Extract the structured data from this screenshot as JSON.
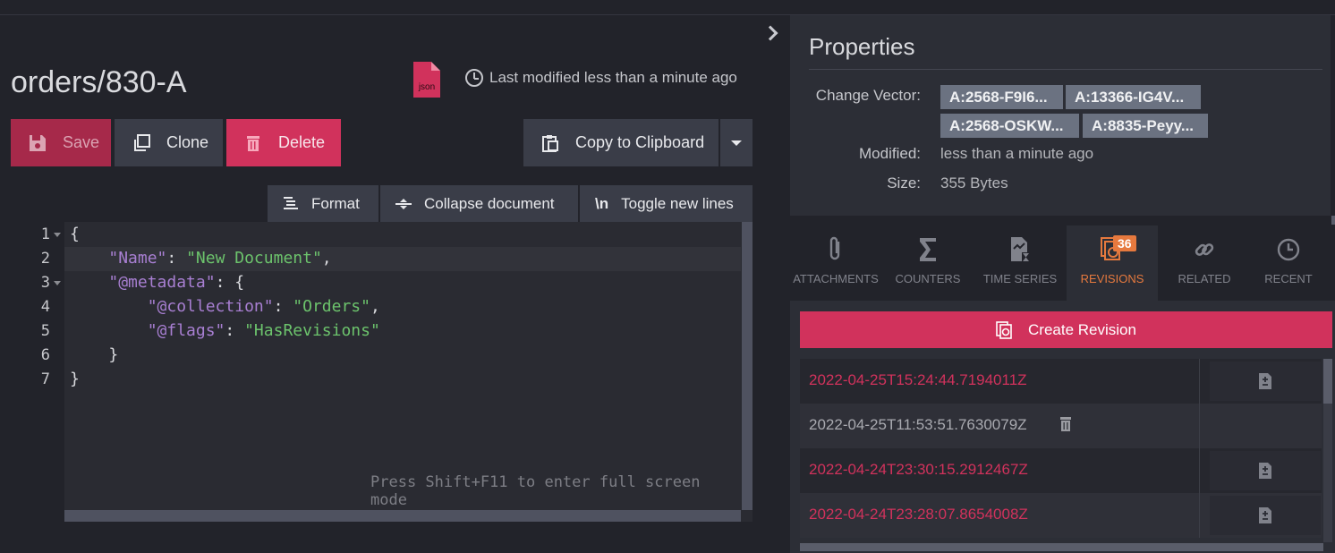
{
  "document": {
    "title": "orders/830-A",
    "json_badge": "json",
    "modified_text": "Last modified less than a minute ago"
  },
  "toolbar": {
    "save_label": "Save",
    "clone_label": "Clone",
    "delete_label": "Delete",
    "copy_label": "Copy to Clipboard"
  },
  "editor_toolbar": {
    "format_label": "Format",
    "collapse_label": "Collapse document",
    "toggle_label": "Toggle new lines",
    "toggle_glyph": "\\n"
  },
  "editor": {
    "line_numbers": [
      "1",
      "2",
      "3",
      "4",
      "5",
      "6",
      "7"
    ],
    "lines": {
      "l1": "{",
      "l2_key": "\"Name\"",
      "l2_sep": ": ",
      "l2_val": "\"New Document\"",
      "l2_end": ",",
      "l3_key": "\"@metadata\"",
      "l3_sep": ": {",
      "l4_key": "\"@collection\"",
      "l4_sep": ": ",
      "l4_val": "\"Orders\"",
      "l4_end": ",",
      "l5_key": "\"@flags\"",
      "l5_sep": ": ",
      "l5_val": "\"HasRevisions\"",
      "l6": "}",
      "l7": "}"
    },
    "hint": "Press Shift+F11 to enter full screen mode"
  },
  "properties": {
    "title": "Properties",
    "change_vector_label": "Change Vector:",
    "change_vectors": [
      "A:2568-F9I6...",
      "A:13366-IG4V...",
      "A:2568-OSKW...",
      "A:8835-Peyy..."
    ],
    "modified_label": "Modified:",
    "modified_value": "less than a minute ago",
    "size_label": "Size:",
    "size_value": "355 Bytes"
  },
  "tabs": [
    {
      "label": "ATTACHMENTS",
      "icon": "paperclip-icon"
    },
    {
      "label": "COUNTERS",
      "icon": "sigma-icon"
    },
    {
      "label": "TIME SERIES",
      "icon": "timeseries-icon"
    },
    {
      "label": "REVISIONS",
      "icon": "revisions-icon",
      "badge": "36",
      "active": true
    },
    {
      "label": "RELATED",
      "icon": "link-icon"
    },
    {
      "label": "RECENT",
      "icon": "clock-icon"
    }
  ],
  "revisions": {
    "create_label": "Create Revision",
    "items": [
      {
        "date": "2022-04-25T15:24:44.7194011Z"
      },
      {
        "date": "2022-04-25T11:53:51.7630079Z"
      },
      {
        "date": "2022-04-24T23:30:15.2912467Z"
      },
      {
        "date": "2022-04-24T23:28:07.8654008Z"
      }
    ]
  },
  "colors": {
    "accent": "#d1325c",
    "active_tab": "#e6793e",
    "json_icon": "#d1325c"
  }
}
